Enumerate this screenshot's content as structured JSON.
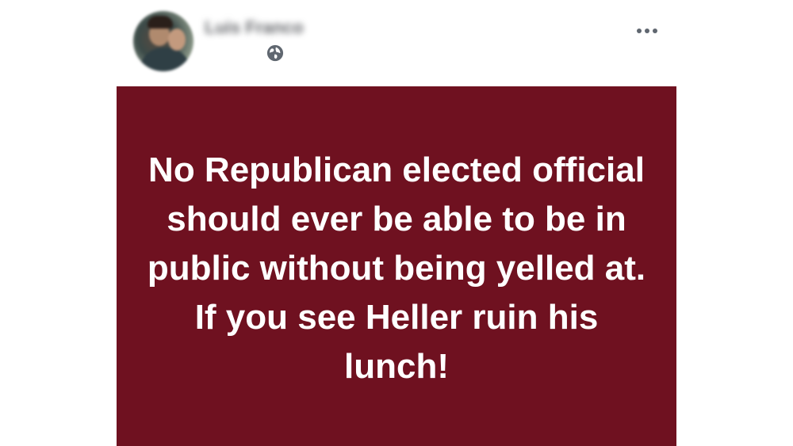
{
  "post": {
    "author_name": "Luis Franco",
    "privacy_icon": "globe-icon",
    "more_icon": "more-options-icon",
    "background_color": "#6f1120",
    "text_color": "#ffffff",
    "text": "No Republican elected official should ever be able to be in public without being yelled at. If you see Heller ruin his lunch!"
  }
}
